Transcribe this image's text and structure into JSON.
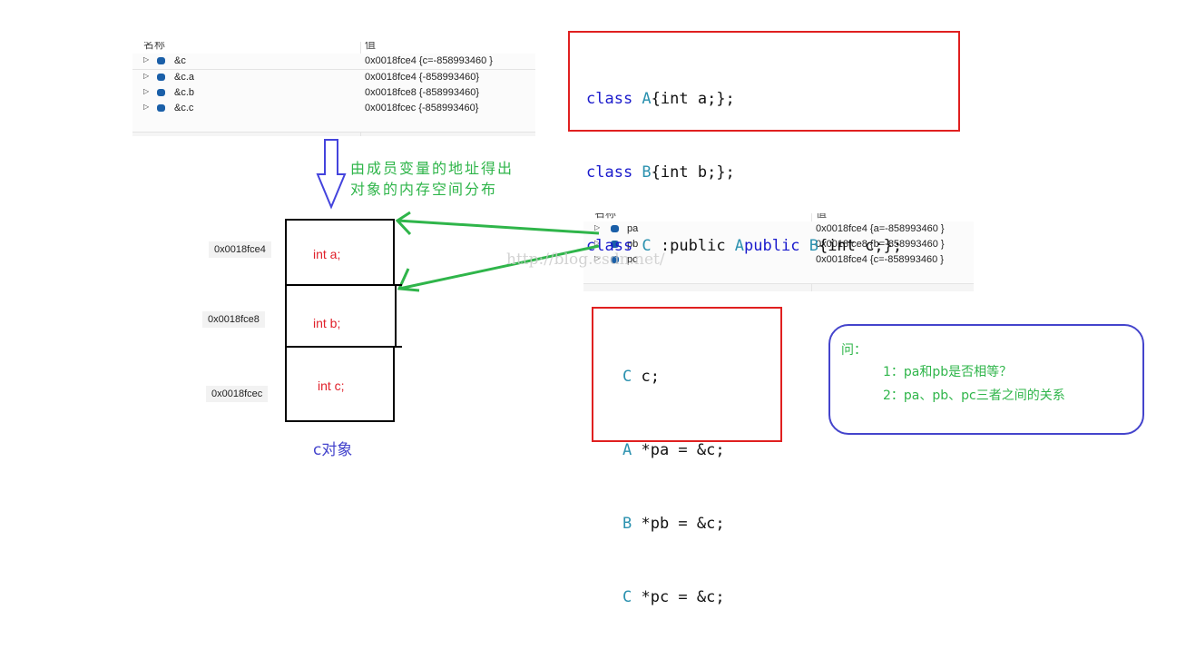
{
  "watch1": {
    "col_name": "名称",
    "col_value": "值",
    "rows": [
      {
        "name": "&c",
        "value": "0x0018fce4 {c=-858993460 }"
      },
      {
        "name": "&c.a",
        "value": "0x0018fce4 {-858993460}"
      },
      {
        "name": "&c.b",
        "value": "0x0018fce8 {-858993460}"
      },
      {
        "name": "&c.c",
        "value": "0x0018fcec {-858993460}"
      }
    ]
  },
  "watch2": {
    "col_name": "名称",
    "col_value": "值",
    "rows": [
      {
        "name": "pa",
        "value": "0x0018fce4 {a=-858993460 }"
      },
      {
        "name": "pb",
        "value": "0x0018fce8 {b=-858993460 }"
      },
      {
        "name": "pc",
        "value": "0x0018fce4 {c=-858993460 }"
      }
    ]
  },
  "class_code": {
    "line1": {
      "kw": "class",
      "type": " A",
      "rest": "{int a;};"
    },
    "line2": {
      "kw": "class",
      "type": " B",
      "rest": "{int b;};"
    },
    "line3": {
      "kw": "class",
      "type": " C",
      "p1": " :public",
      "a": " A",
      ", ": ", ",
      "p2": "public",
      "b": " B",
      "rest": "{int c;};"
    }
  },
  "annotation": {
    "line1": "由成员变量的地址得出",
    "line2": "对象的内存空间分布"
  },
  "memory": {
    "cells": [
      "int  a;",
      "int  b;",
      "int  c;"
    ],
    "addresses": [
      "0x0018fce4",
      "0x0018fce8",
      "0x0018fcec"
    ],
    "label": "c对象"
  },
  "decl_code": [
    {
      "type": "C",
      "rest": " c;"
    },
    {
      "type": "A",
      "rest": " *pa = &c;"
    },
    {
      "type": "B",
      "rest": " *pb = &c;"
    },
    {
      "type": "C",
      "rest": " *pc = &c;"
    }
  ],
  "question": {
    "title": "问：",
    "q1": "1：pa和pb是否相等？",
    "q2": "2：pa、pb、pc三者之间的关系"
  },
  "watermark": "http://blog.csdn.net/",
  "colors": {
    "red_box": "#e02020",
    "blue_box": "#4444cc",
    "arrow_green": "#2fb54a",
    "arrow_blue": "#4444dd"
  }
}
